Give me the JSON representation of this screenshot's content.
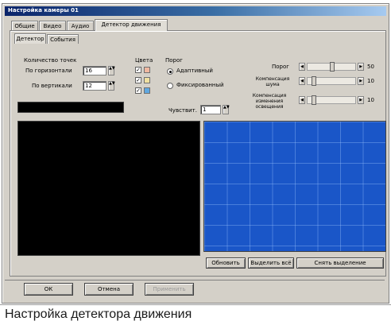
{
  "window": {
    "title": "Настройка камеры 01",
    "tabs": [
      "Общие",
      "Видео",
      "Аудио",
      "Детектор движения"
    ],
    "subtabs": [
      "Детектор",
      "События"
    ]
  },
  "detector": {
    "points_group": "Количество точек",
    "horizontal_label": "По горизонтали",
    "horizontal_value": "16",
    "vertical_label": "По вертикали",
    "vertical_value": "12",
    "color_group": "Цвета",
    "mode_group": "Порог",
    "mode_adaptive": "Адаптивный",
    "mode_fixed": "Фиксированный",
    "threshold_label": "Порог",
    "threshold_value": "50",
    "compensation_label": "Компенсация шума",
    "compensation_value": "10",
    "compensation2_label": "Компенсация изменения освещения",
    "compensation2_value": "10",
    "sensitivity_label": "Чувствит.",
    "sensitivity_value": "1",
    "reset_button": "Обновить",
    "select_all_button": "Выделить всё",
    "clear_selection_button": "Снять выделение"
  },
  "footer": {
    "ok_button": "ОК",
    "cancel_button": "Отмена",
    "apply_button": "Применить"
  },
  "caption": "Настройка детектора движения",
  "colors": {
    "title_bar": "#0a246a",
    "grid_fill": "#1a56c8",
    "swatch_1": "#f0b8a0",
    "swatch_2": "#f0e0a0",
    "swatch_3": "#60a8e0"
  }
}
